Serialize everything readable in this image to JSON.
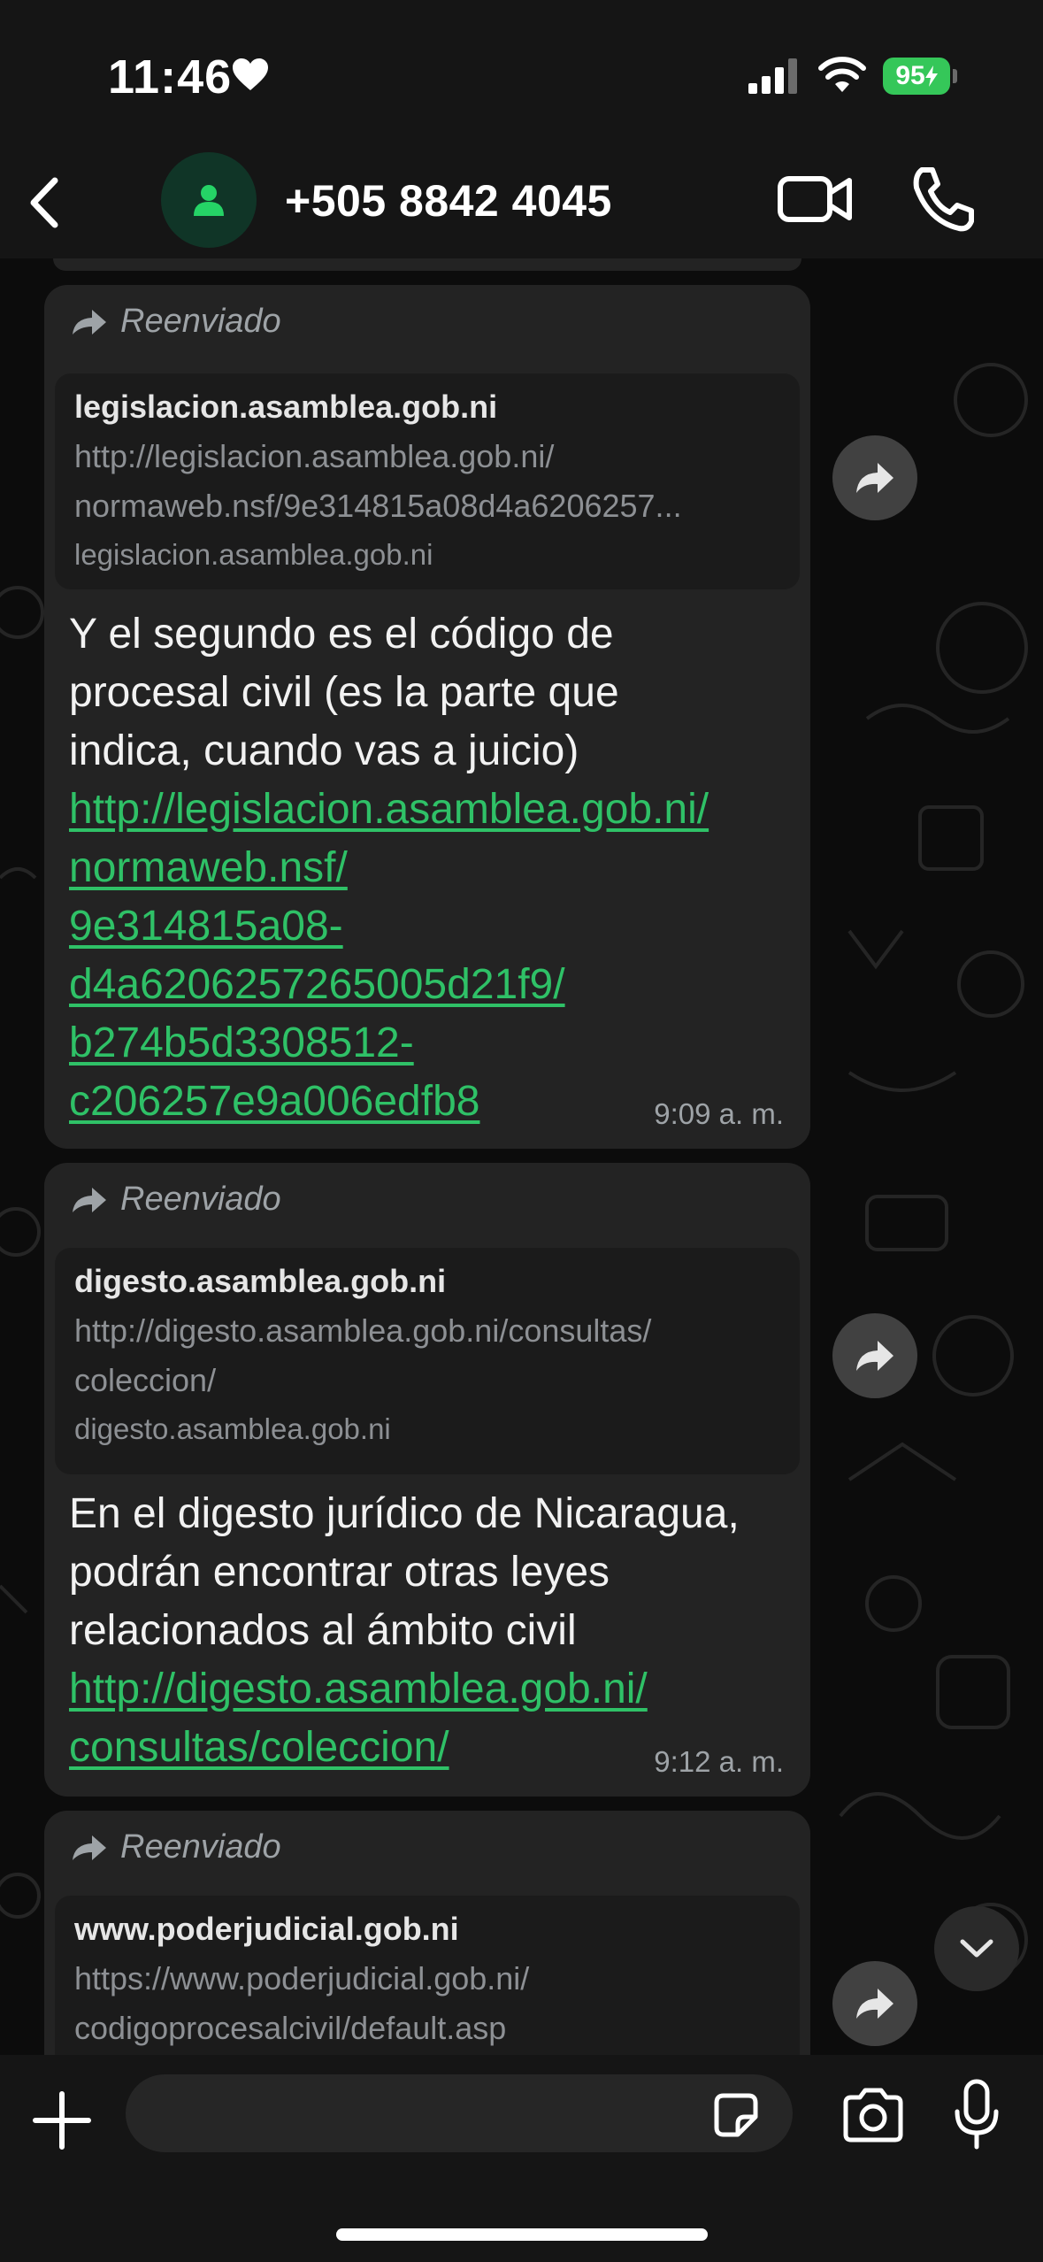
{
  "status_bar": {
    "time": "11:46",
    "battery": "95"
  },
  "header": {
    "contact_name": "+505 8842 4045"
  },
  "messages": [
    {
      "forwarded_label": "Reenviado",
      "preview": {
        "title": "legislacion.asamblea.gob.ni",
        "description_1": "http://legislacion.asamblea.gob.ni/",
        "description_2": "normaweb.nsf/9e314815a08d4a6206257...",
        "host": "legislacion.asamblea.gob.ni"
      },
      "text_lines": [
        "Y el segundo es el código de",
        "procesal civil (es la parte que",
        "indica, cuando vas a juicio)"
      ],
      "link_lines": [
        "http://legislacion.asamblea.gob.ni/",
        "normaweb.nsf/",
        "9e314815a08-",
        "d4a6206257265005d21f9/",
        "b274b5d3308512-",
        "c206257e9a006edfb8"
      ],
      "time": "9:09 a. m."
    },
    {
      "forwarded_label": "Reenviado",
      "preview": {
        "title": "digesto.asamblea.gob.ni",
        "description_1": "http://digesto.asamblea.gob.ni/consultas/",
        "description_2": "coleccion/",
        "host": "digesto.asamblea.gob.ni"
      },
      "text_lines": [
        "En el digesto jurídico de Nicaragua,",
        "podrán encontrar otras leyes",
        "relacionados al ámbito civil"
      ],
      "link_lines": [
        "http://digesto.asamblea.gob.ni/",
        "consultas/coleccion/"
      ],
      "time": "9:12 a. m."
    },
    {
      "forwarded_label": "Reenviado",
      "preview": {
        "title": "www.poderjudicial.gob.ni",
        "description_1": "https://www.poderjudicial.gob.ni/",
        "description_2": "codigoprocesalcivil/default.asp"
      }
    }
  ],
  "composer": {
    "placeholder": ""
  },
  "colors": {
    "link": "#2fc167",
    "bubble": "#232323",
    "battery": "#35c759",
    "avatar_icon": "#25d366"
  },
  "icons": [
    "back-icon",
    "person-icon",
    "video-call-icon",
    "phone-icon",
    "forward-icon",
    "share-icon",
    "chevron-down-icon",
    "plus-icon",
    "sticker-icon",
    "camera-icon",
    "mic-icon"
  ]
}
